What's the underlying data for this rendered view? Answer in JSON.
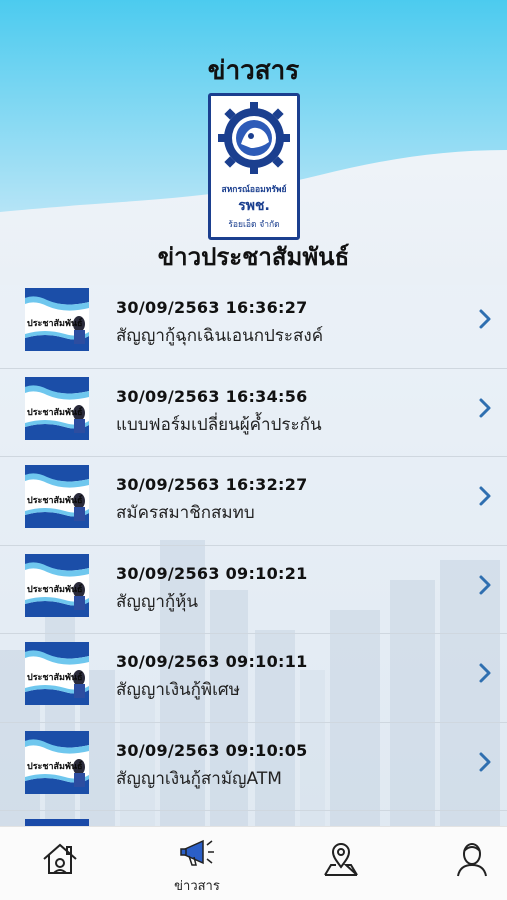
{
  "header": {
    "title": "ข่าวสาร",
    "section_title": "ข่าวประชาสัมพันธ์",
    "logo_text_line1": "สหกรณ์ออมทรัพย์",
    "logo_text_line2": "รพช.",
    "logo_text_line3": "ร้อยเอ็ด จำกัด"
  },
  "news": [
    {
      "thumb_label": "ประชาสัมพันธ์",
      "date": "30/09/2563 16:36:27",
      "title": "สัญญากู้ฉุกเฉินเอนกประสงค์"
    },
    {
      "thumb_label": "ประชาสัมพันธ์",
      "date": "30/09/2563 16:34:56",
      "title": "แบบฟอร์มเปลี่ยนผู้ค้ำประกัน"
    },
    {
      "thumb_label": "ประชาสัมพันธ์",
      "date": "30/09/2563 16:32:27",
      "title": "สมัครสมาชิกสมทบ"
    },
    {
      "thumb_label": "ประชาสัมพันธ์",
      "date": "30/09/2563 09:10:21",
      "title": "สัญญากู้หุ้น"
    },
    {
      "thumb_label": "ประชาสัมพันธ์",
      "date": "30/09/2563 09:10:11",
      "title": "สัญญาเงินกู้พิเศษ"
    },
    {
      "thumb_label": "ประชาสัมพันธ์",
      "date": "30/09/2563 09:10:05",
      "title": "สัญญาเงินกู้สามัญATM"
    }
  ],
  "tabbar": {
    "items": [
      {
        "icon": "home-icon",
        "label": ""
      },
      {
        "icon": "megaphone-icon",
        "label": "ข่าวสาร"
      },
      {
        "icon": "map-pin-icon",
        "label": ""
      },
      {
        "icon": "user-icon",
        "label": ""
      }
    ]
  },
  "colors": {
    "header_gradient_top": "#4fc6ef",
    "header_gradient_bottom": "#a6dff5",
    "logo_blue": "#1b3f8f",
    "chevron": "#2f6fb0",
    "active_icon": "#2b5fc7"
  }
}
